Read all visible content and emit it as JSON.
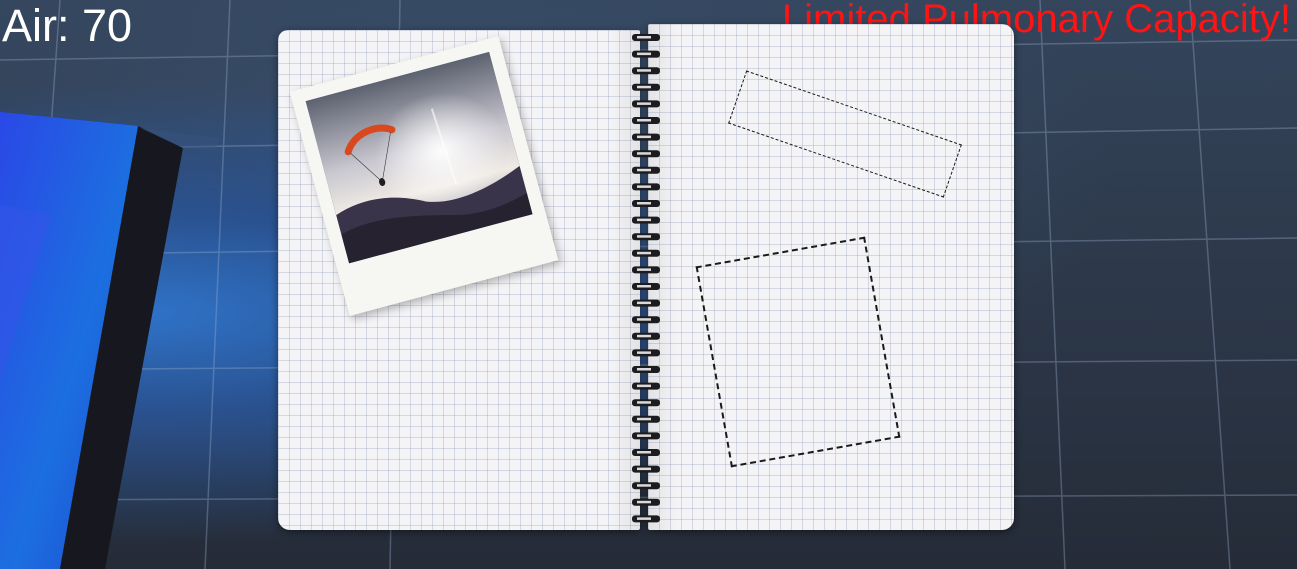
{
  "hud": {
    "air_text": "Air: 70",
    "warning_text": "Limited Pulmonary Capacity!",
    "warning_color": "#ff1414"
  },
  "notebook": {
    "left_page": {
      "photo": {
        "subject": "paraglider over a lake at sunset",
        "sail_color": "#d8491f"
      }
    },
    "right_page": {
      "photo_slots": [
        {
          "name": "empty-photo-slot-1",
          "style": "dashed outline"
        },
        {
          "name": "empty-photo-slot-2",
          "style": "dashed outline"
        }
      ]
    },
    "binding": "spiral"
  },
  "colors": {
    "background": "#2c3748",
    "block_face": "#1f3fd6",
    "block_edge": "#17181f",
    "paper": "#f4f4f7"
  }
}
